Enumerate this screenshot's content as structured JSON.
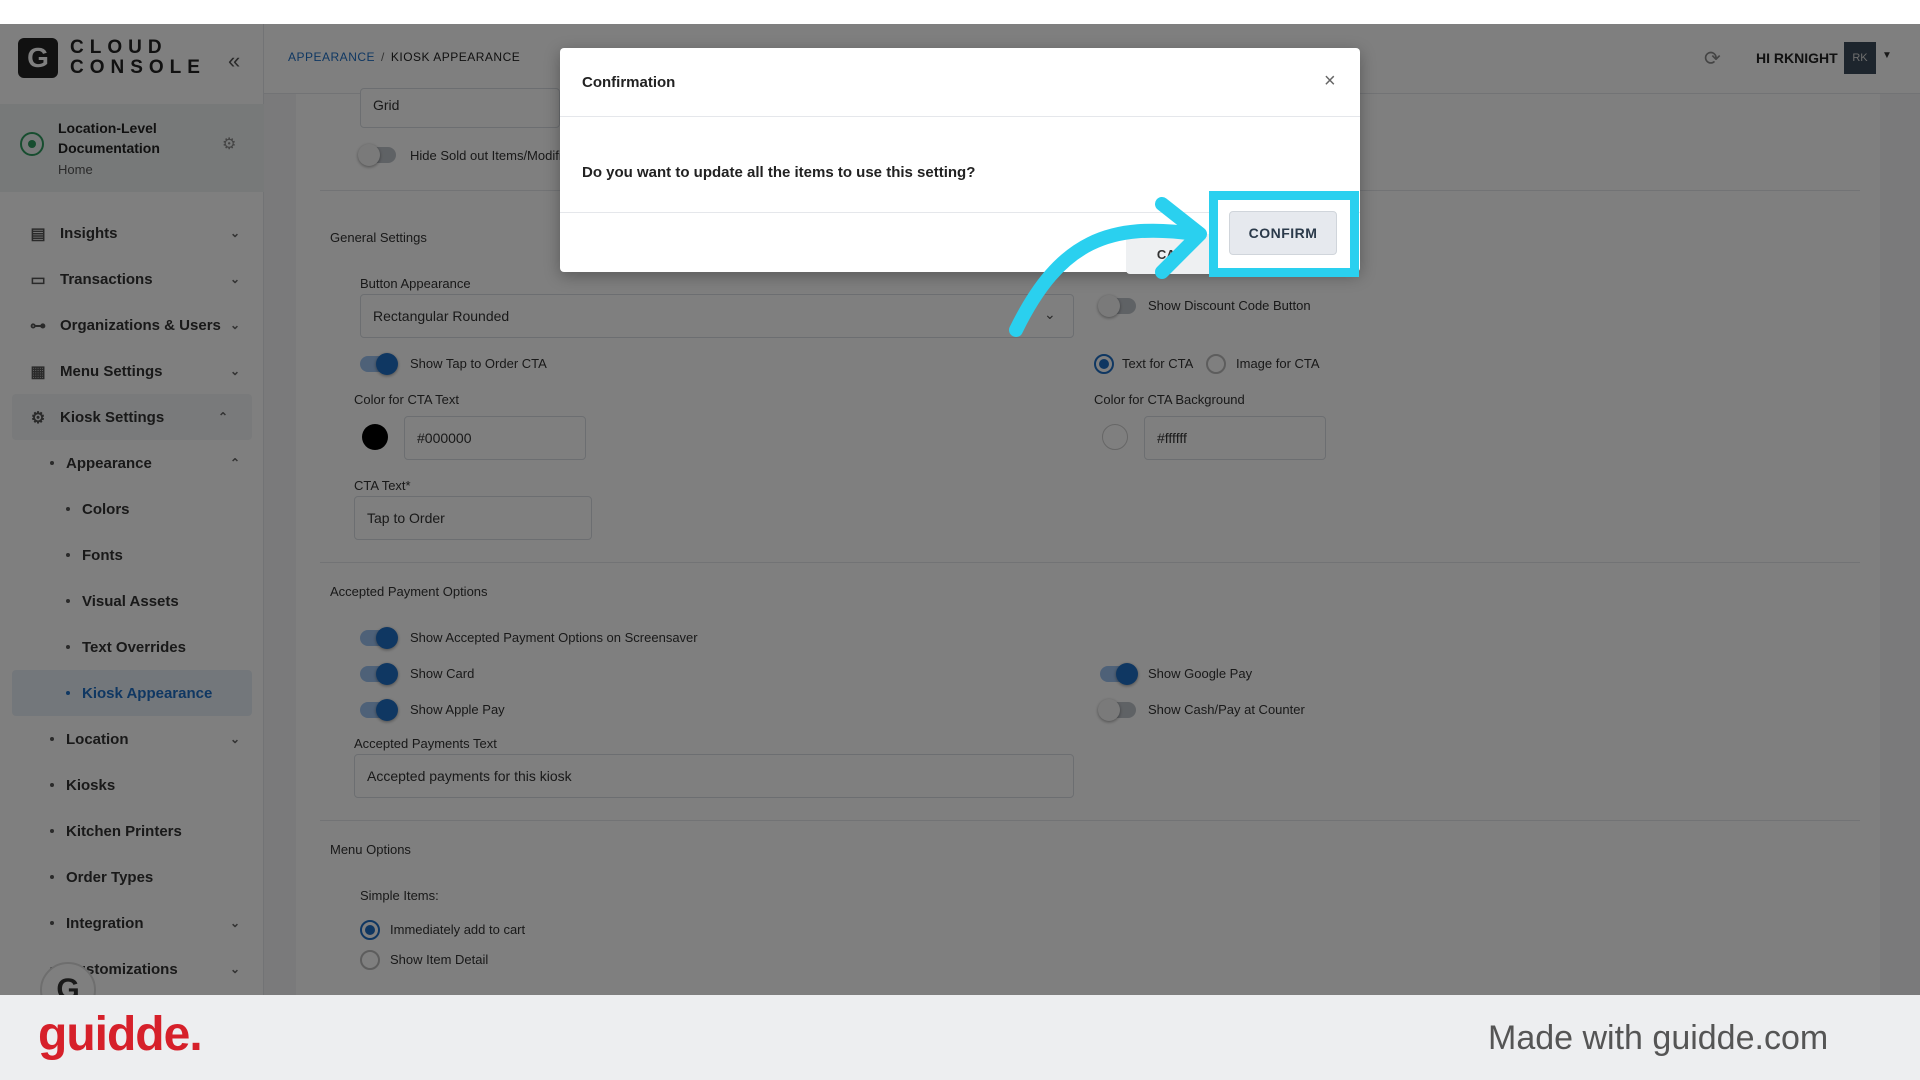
{
  "app": {
    "logo_letter": "G",
    "logo_text": "CLOUD\nCONSOLE"
  },
  "location": {
    "name": "Location-Level Documentation",
    "sub": "Home"
  },
  "nav": {
    "insights": "Insights",
    "transactions": "Transactions",
    "organizations": "Organizations & Users",
    "menu_settings": "Menu Settings",
    "kiosk_settings": "Kiosk Settings",
    "appearance": "Appearance",
    "colors": "Colors",
    "fonts": "Fonts",
    "visual_assets": "Visual Assets",
    "text_overrides": "Text Overrides",
    "kiosk_appearance": "Kiosk Appearance",
    "location": "Location",
    "kiosks": "Kiosks",
    "kitchen_printers": "Kitchen Printers",
    "order_types": "Order Types",
    "integration": "Integration",
    "customizations": "Customizations"
  },
  "header": {
    "breadcrumb_link": "APPEARANCE",
    "breadcrumb_sep": "/",
    "breadcrumb_current": "KIOSK APPEARANCE",
    "user_label": "HI RKNIGHT",
    "avatar_initials": "RK"
  },
  "content": {
    "grid_value": "Grid",
    "hide_sold_out": "Hide Sold out Items/Modifiers",
    "general_settings": "General Settings",
    "button_appearance_label": "Button Appearance",
    "button_appearance_value": "Rectangular Rounded",
    "show_discount_code": "Show Discount Code Button",
    "show_tap_to_order": "Show Tap to Order CTA",
    "text_for_cta": "Text for CTA",
    "image_for_cta": "Image for CTA",
    "color_cta_text_label": "Color for CTA Text",
    "color_cta_text_value": "#000000",
    "color_cta_bg_label": "Color for CTA Background",
    "color_cta_bg_value": "#ffffff",
    "cta_text_label": "CTA Text*",
    "cta_text_value": "Tap to Order",
    "accepted_payment_options": "Accepted Payment Options",
    "show_payment_on_screensaver": "Show Accepted Payment Options on Screensaver",
    "show_card": "Show Card",
    "show_google_pay": "Show Google Pay",
    "show_apple_pay": "Show Apple Pay",
    "show_cash": "Show Cash/Pay at Counter",
    "accepted_payments_text_label": "Accepted Payments Text",
    "accepted_payments_text_value": "Accepted payments for this kiosk",
    "menu_options": "Menu Options",
    "simple_items": "Simple Items:",
    "immediately_add": "Immediately add to cart",
    "show_item_detail": "Show Item Detail"
  },
  "modal": {
    "title": "Confirmation",
    "body": "Do you want to update all the items to use this setting?",
    "cancel": "CAN",
    "confirm": "CONFIRM"
  },
  "footer": {
    "brand": "guidde.",
    "made_with": "Made with guidde.com"
  },
  "colors": {
    "accent": "#1f6fc5",
    "highlight": "#2ad0ef",
    "brand": "#d6202a"
  }
}
